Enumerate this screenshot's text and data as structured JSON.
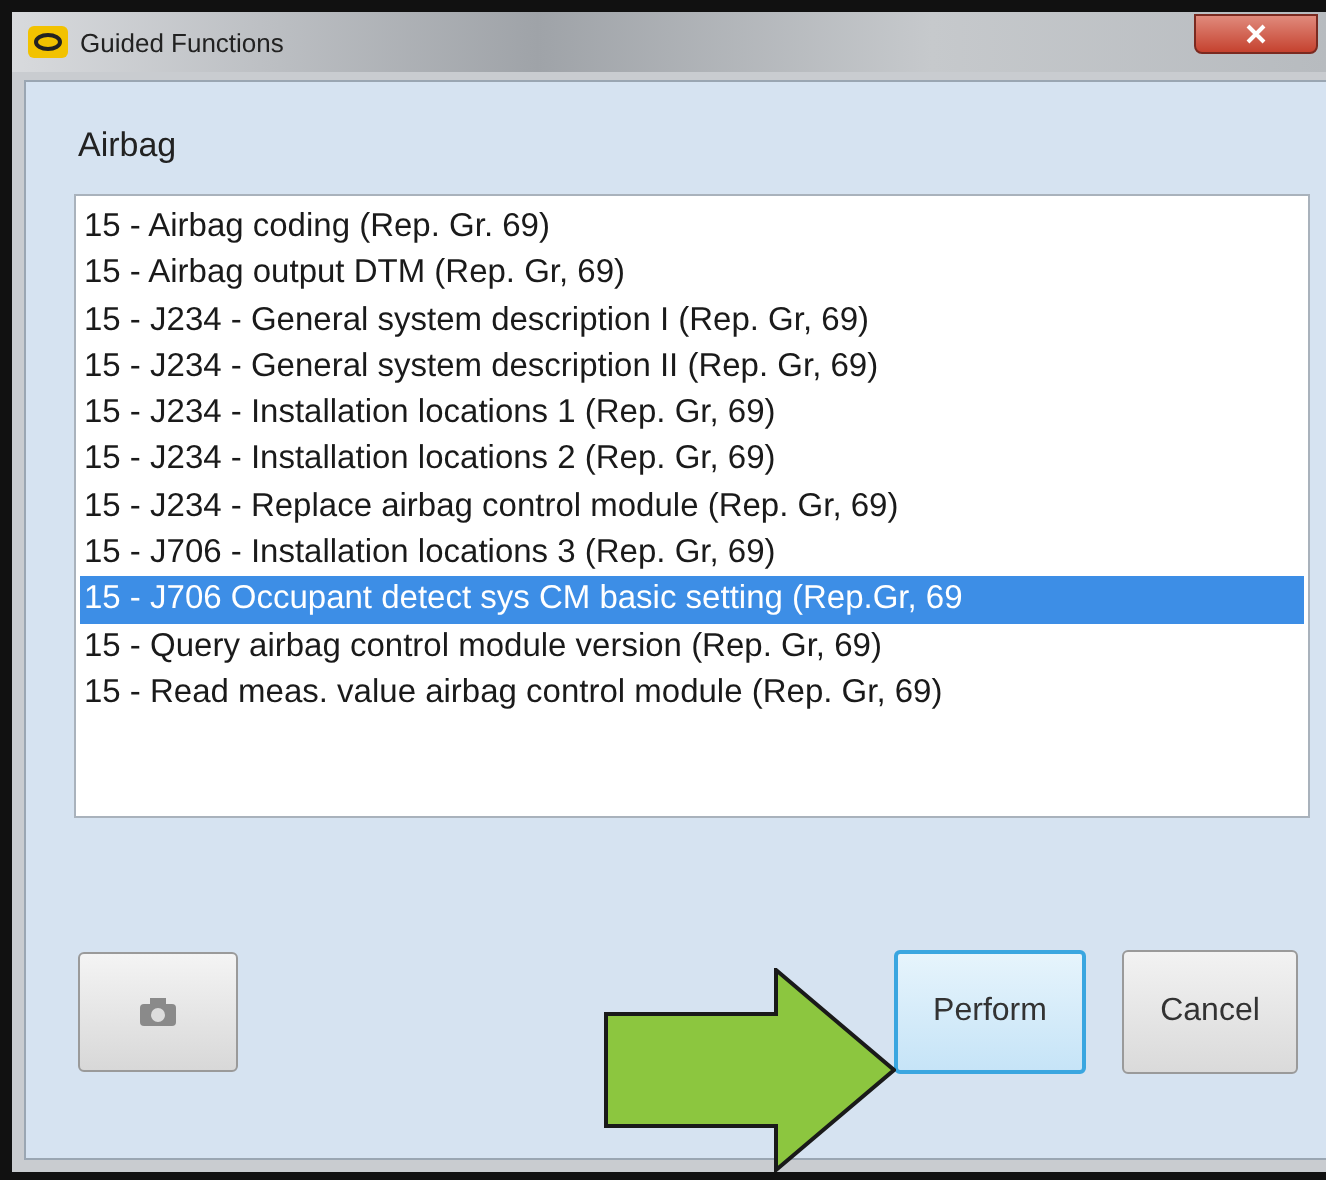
{
  "window": {
    "title": "Guided Functions"
  },
  "group": {
    "label": "Airbag"
  },
  "list": {
    "items": [
      {
        "label": "15 - Airbag coding (Rep. Gr. 69)",
        "selected": false
      },
      {
        "label": "15 - Airbag output DTM (Rep. Gr, 69)",
        "selected": false
      },
      {
        "label": "15 - J234 - General system description I (Rep. Gr, 69)",
        "selected": false
      },
      {
        "label": "15 - J234 - General system description II (Rep. Gr, 69)",
        "selected": false
      },
      {
        "label": "15 - J234 - Installation locations 1 (Rep. Gr, 69)",
        "selected": false
      },
      {
        "label": "15 - J234 - Installation locations 2 (Rep. Gr, 69)",
        "selected": false
      },
      {
        "label": "15 - J234 - Replace airbag control module (Rep. Gr, 69)",
        "selected": false
      },
      {
        "label": "15 - J706 - Installation locations 3 (Rep. Gr, 69)",
        "selected": false
      },
      {
        "label": "15 - J706 Occupant detect sys CM basic setting (Rep.Gr, 69",
        "selected": true
      },
      {
        "label": "15 - Query airbag control module version (Rep. Gr, 69)",
        "selected": false
      },
      {
        "label": "15 - Read meas. value airbag control module (Rep. Gr, 69)",
        "selected": false
      }
    ]
  },
  "buttons": [
    {
      "label": "Perform",
      "focused": true
    },
    {
      "label": "Cancel",
      "focused": false
    }
  ]
}
